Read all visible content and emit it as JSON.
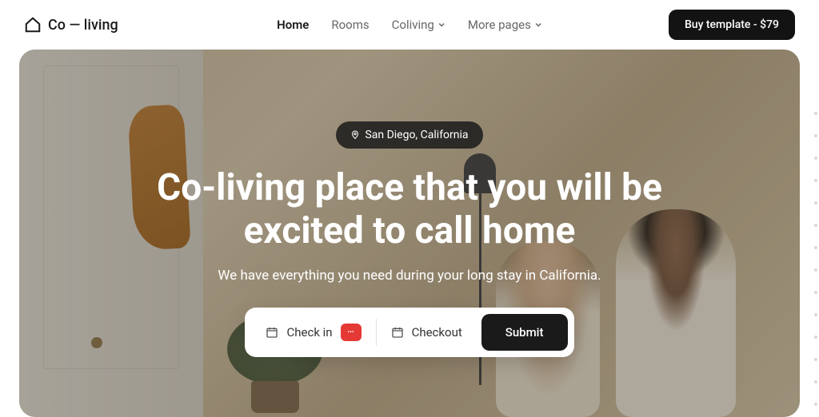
{
  "header": {
    "logo_text": "Co — living",
    "nav": [
      {
        "label": "Home",
        "active": true,
        "dropdown": false
      },
      {
        "label": "Rooms",
        "active": false,
        "dropdown": false
      },
      {
        "label": "Coliving",
        "active": false,
        "dropdown": true
      },
      {
        "label": "More pages",
        "active": false,
        "dropdown": true
      }
    ],
    "cta_label": "Buy template - $79"
  },
  "hero": {
    "location": "San Diego, California",
    "title": "Co-living place that you will be excited to call home",
    "subtitle": "We have everything you need during your long stay in California."
  },
  "booking": {
    "checkin_label": "Check in",
    "checkout_label": "Checkout",
    "submit_label": "Submit"
  }
}
